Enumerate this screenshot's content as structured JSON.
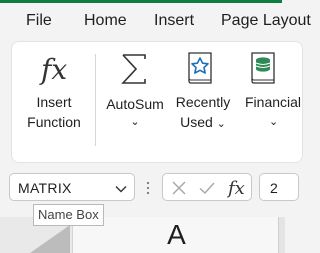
{
  "colors": {
    "accent": "#107c41",
    "icon_blue": "#1f6fb8",
    "icon_green": "#2e8b57"
  },
  "menu": {
    "items": [
      {
        "label": "File"
      },
      {
        "label": "Home"
      },
      {
        "label": "Insert"
      },
      {
        "label": "Page Layout"
      }
    ]
  },
  "ribbon": {
    "insert_function": {
      "line1": "Insert",
      "line2": "Function",
      "icon": "fx-icon"
    },
    "autosum": {
      "label": "AutoSum",
      "chevron": "⌄",
      "icon": "sigma-icon"
    },
    "recently_used": {
      "line1": "Recently",
      "line2": "Used",
      "chevron": "⌄",
      "icon": "star-book-icon"
    },
    "financial": {
      "line1": "Financial",
      "chevron": "⌄",
      "icon": "coins-book-icon"
    }
  },
  "name_box": {
    "value": "MATRIX",
    "tooltip": "Name Box"
  },
  "formula_bar": {
    "cancel_icon": "close-icon",
    "enter_icon": "check-icon",
    "function_label": "fx",
    "value": "2"
  },
  "grid": {
    "column_header": "A"
  }
}
